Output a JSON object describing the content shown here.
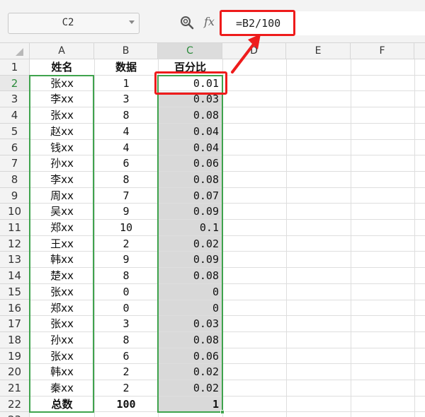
{
  "formula_bar": {
    "cell_ref": "C2",
    "formula": "=B2/100"
  },
  "icons": {
    "zoom": "zoom-icon",
    "fx": "fx"
  },
  "columns": [
    "A",
    "B",
    "C",
    "D",
    "E",
    "F"
  ],
  "selected_column": "C",
  "selected_cell": "C2",
  "rows": [
    {
      "n": "1",
      "a": "姓名",
      "b": "数据",
      "c": "百分比",
      "bold": true
    },
    {
      "n": "2",
      "a": "张xx",
      "b": "1",
      "c": "0.01"
    },
    {
      "n": "3",
      "a": "李xx",
      "b": "3",
      "c": "0.03"
    },
    {
      "n": "4",
      "a": "张xx",
      "b": "8",
      "c": "0.08"
    },
    {
      "n": "5",
      "a": "赵xx",
      "b": "4",
      "c": "0.04"
    },
    {
      "n": "6",
      "a": "钱xx",
      "b": "4",
      "c": "0.04"
    },
    {
      "n": "7",
      "a": "孙xx",
      "b": "6",
      "c": "0.06"
    },
    {
      "n": "8",
      "a": "李xx",
      "b": "8",
      "c": "0.08"
    },
    {
      "n": "9",
      "a": "周xx",
      "b": "7",
      "c": "0.07"
    },
    {
      "n": "10",
      "a": "吴xx",
      "b": "9",
      "c": "0.09"
    },
    {
      "n": "11",
      "a": "郑xx",
      "b": "10",
      "c": "0.1"
    },
    {
      "n": "12",
      "a": "王xx",
      "b": "2",
      "c": "0.02"
    },
    {
      "n": "13",
      "a": "韩xx",
      "b": "9",
      "c": "0.09"
    },
    {
      "n": "14",
      "a": "楚xx",
      "b": "8",
      "c": "0.08"
    },
    {
      "n": "15",
      "a": "张xx",
      "b": "0",
      "c": "0"
    },
    {
      "n": "16",
      "a": "郑xx",
      "b": "0",
      "c": "0"
    },
    {
      "n": "17",
      "a": "张xx",
      "b": "3",
      "c": "0.03"
    },
    {
      "n": "18",
      "a": "孙xx",
      "b": "8",
      "c": "0.08"
    },
    {
      "n": "19",
      "a": "张xx",
      "b": "6",
      "c": "0.06"
    },
    {
      "n": "20",
      "a": "韩xx",
      "b": "2",
      "c": "0.02"
    },
    {
      "n": "21",
      "a": "秦xx",
      "b": "2",
      "c": "0.02"
    },
    {
      "n": "22",
      "a": "总数",
      "b": "100",
      "c": "1",
      "bold": true
    },
    {
      "n": "23",
      "a": "",
      "b": "",
      "c": ""
    }
  ],
  "colors": {
    "selection_green": "#3fa34d",
    "annotation_red": "#ee1b1b",
    "selected_fill": "#d9d9d9"
  }
}
